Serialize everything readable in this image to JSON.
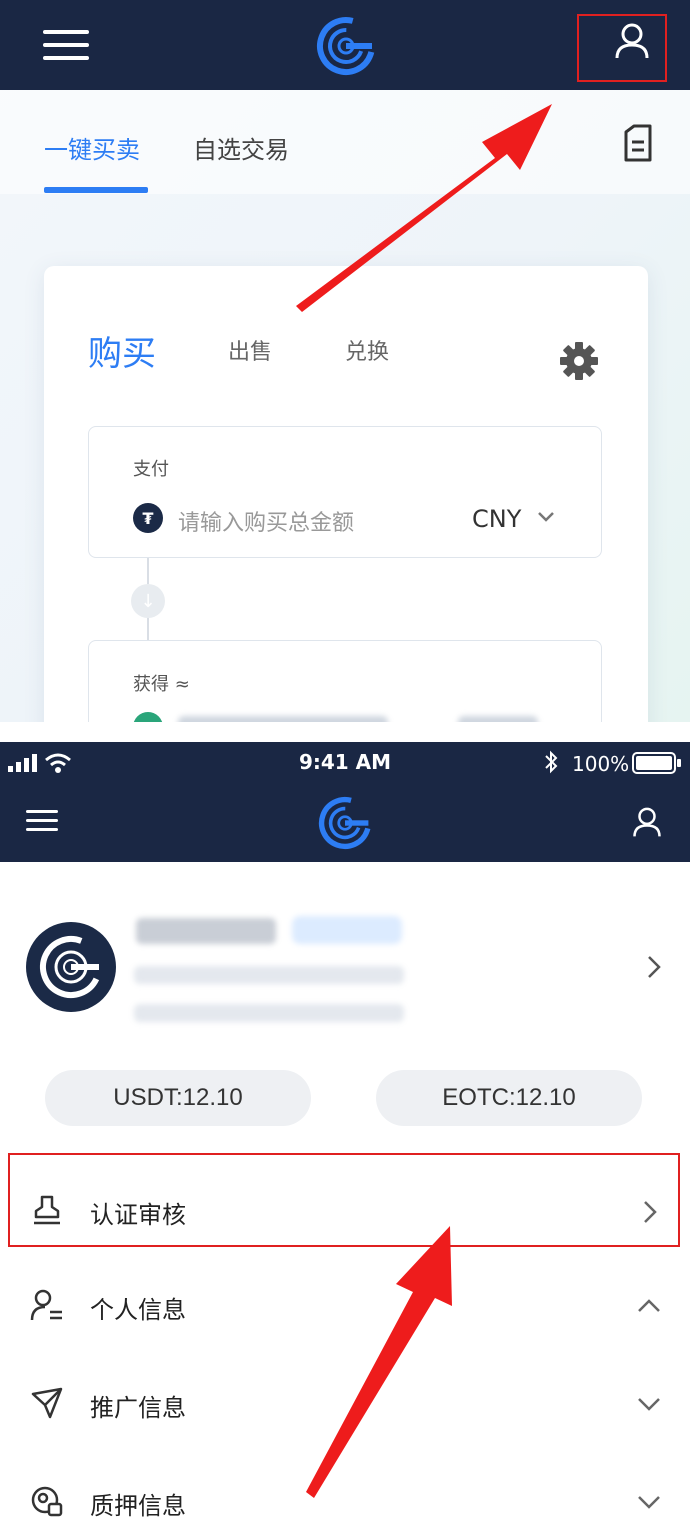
{
  "top_screen": {
    "tabs": [
      {
        "label": "一键买卖",
        "active": true
      },
      {
        "label": "自选交易",
        "active": false
      }
    ],
    "card": {
      "tabs": [
        {
          "label": "购买",
          "active": true
        },
        {
          "label": "出售",
          "active": false
        },
        {
          "label": "兑换",
          "active": false
        }
      ],
      "pay_field": {
        "label": "支付",
        "coin_symbol": "₮",
        "placeholder": "请输入购买总金额",
        "currency": "CNY"
      },
      "receive_field": {
        "label": "获得 ≈"
      }
    },
    "highlight_color": "#e02020",
    "brand_color": "#1a2744",
    "accent_color": "#2d7df4"
  },
  "status_bar": {
    "time": "9:41 AM",
    "battery": "100%"
  },
  "profile": {
    "balances": [
      {
        "label": "USDT:12.10"
      },
      {
        "label": "EOTC:12.10"
      }
    ]
  },
  "menu": [
    {
      "label": "认证审核",
      "icon": "stamp-icon",
      "arrow": "chevron-right",
      "highlighted": true
    },
    {
      "label": "个人信息",
      "icon": "person-list-icon",
      "arrow": "chevron-up"
    },
    {
      "label": "推广信息",
      "icon": "paper-plane-icon",
      "arrow": "chevron-down"
    },
    {
      "label": "质押信息",
      "icon": "pledge-icon",
      "arrow": "chevron-down"
    }
  ]
}
